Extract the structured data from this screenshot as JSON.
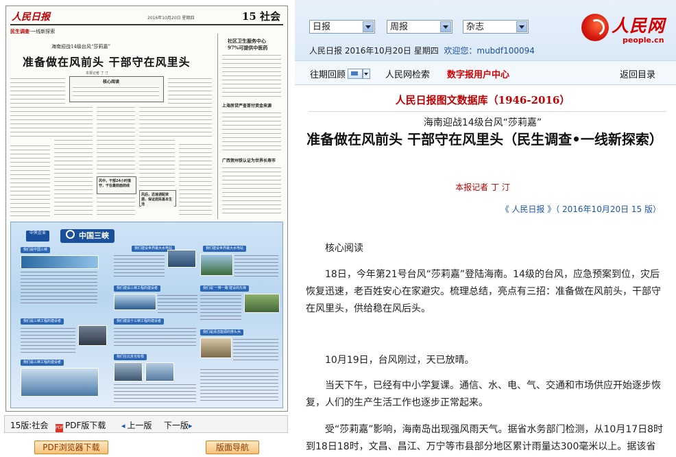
{
  "newspaper_page": {
    "masthead": "人民日报",
    "date_line": "2016年10月20日 星期四",
    "section": "15 社会",
    "column_tag_prefix": "民生调查",
    "column_tag_suffix": "一线新探索",
    "kicker": "海南迎战14级台风“莎莉嘉”",
    "headline": "准备做在风前头 干部守在风里头",
    "box_titles": [
      "核心阅读",
      "风中，干部24小时值守，干在最前面前线",
      "风后，迅速调配资源，保证居民基本生活"
    ],
    "side_titles": [
      "社区卫生服务中心",
      "97%可提供中医药",
      "上海房贷严查首付资金来源",
      "广西贺州铁认证为世界长寿市"
    ],
    "ad": {
      "badge": "中央企业",
      "logo": "中国三峡",
      "tabs": [
        "我们是中国三峡",
        "我们建设世界最大水电站",
        "我们建设世界最大水电站",
        "我们建设三峡工程的建设者",
        "我们建造十三峡工程的建设者",
        "我们是‘一带一路’建设的先锋",
        "我们是三峡工程的建设者",
        "我们是清洁能源的排头兵",
        "我们在北京也有根",
        "我们是三峡工程的建设者"
      ]
    }
  },
  "page_nav": {
    "page_label": "15版:社会",
    "pdf_download": "PDF版下载",
    "prev_page": "上一版",
    "next_page": "下一版"
  },
  "bottom_buttons": {
    "pdf_browser": "PDF浏览器下载",
    "layout_nav": "版面导航"
  },
  "toolbar": {
    "select_daily": "日报",
    "select_weekly": "周报",
    "select_magazine": "杂志",
    "info_prefix": "人民日报 2016年10月20日 星期四",
    "welcome": "欢迎您：",
    "username": "mubdf100094"
  },
  "logo": {
    "name": "人民网",
    "url": "people.cn"
  },
  "nav": {
    "back_issues": "往期回顾",
    "search": "人民网检索",
    "digital_center": "数字报用户中心",
    "back_to_index": "返回目录"
  },
  "article": {
    "database_title": "人民日报图文数据库（1946-2016）",
    "subheadline": "海南迎战14级台风“莎莉嘉”",
    "headline": "准备做在风前头 干部守在风里头（民生调查•一线新探索）",
    "reporter": "本报记者 丁 汀",
    "source": "《 人民日报 》（ 2016年10月20日   15 版）",
    "paragraphs": [
      "核心阅读",
      "18日，今年第21号台风“莎莉嘉”登陆海南。14级的台风，应急预案到位，灾后恢复迅速，老百姓安心在家避灾。梳理总结，亮点有三招：准备做在风前头，干部守在风里头，供给稳在风后头。",
      "10月19日，台风刚过，天已放晴。",
      "当天下午，已经有中小学复课。通信、水、电、气、交通和市场供应开始逐步恢复，人们的生产生活工作也逐步正常起来。",
      "受“莎莉嘉”影响，海南岛出现强风雨天气。据省水务部门检测，从10月17日8时到18日18时，文昌、昌江、万宁等市县部分地区累计雨量达300毫米以上。据该省气"
    ]
  },
  "colors": {
    "accent_red": "#c00000",
    "link_blue": "#1a56a8",
    "header_bg": "#dbe9f7"
  }
}
